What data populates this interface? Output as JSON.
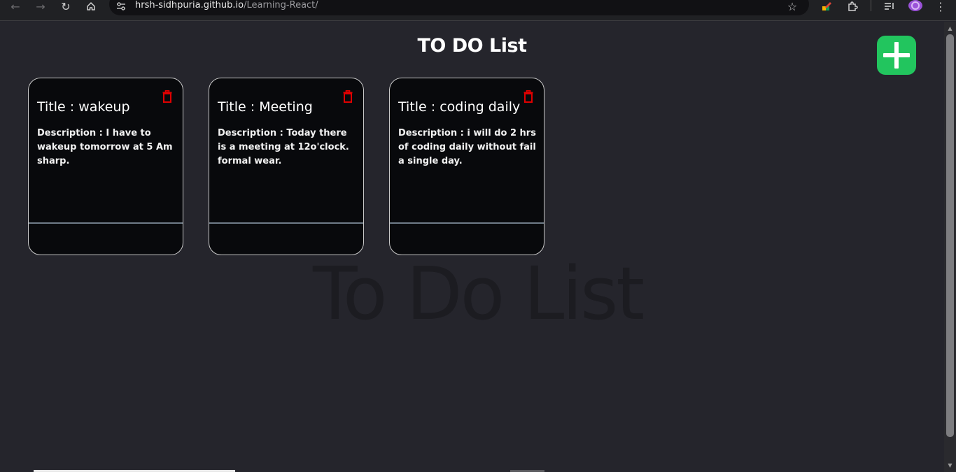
{
  "browser": {
    "url_host": "hrsh-sidhpuria.github.io",
    "url_path": "/Learning-React/"
  },
  "page": {
    "title": "TO DO List",
    "watermark": "To Do List"
  },
  "todos": [
    {
      "title": "Title : wakeup",
      "description": "Description : I have to wakeup tomorrow at 5 Am sharp."
    },
    {
      "title": "Title : Meeting",
      "description": "Description : Today there is a meeting at 12o'clock. formal wear."
    },
    {
      "title": "Title : coding daily",
      "description": "Description : i will do 2 hrs of coding daily without fail a single day."
    }
  ],
  "colors": {
    "background": "#25252c",
    "card_background": "#08090c",
    "add_button": "#22c55e",
    "trash_icon": "#e00000"
  }
}
